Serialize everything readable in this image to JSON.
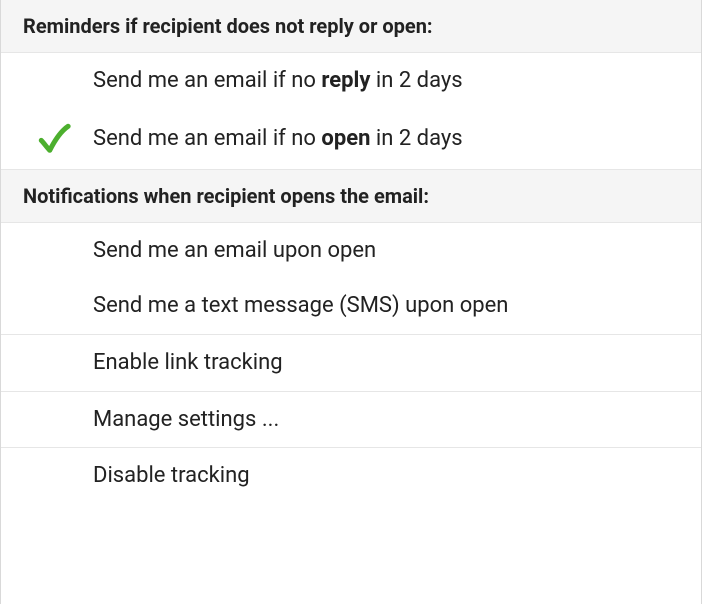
{
  "sections": {
    "reminders": {
      "header": "Reminders if recipient does not reply or open:",
      "items": {
        "no_reply": {
          "prefix": "Send me an email if no ",
          "bold": "reply",
          "suffix": " in 2 days",
          "checked": false
        },
        "no_open": {
          "prefix": "Send me an email if no ",
          "bold": "open",
          "suffix": " in 2 days",
          "checked": true
        }
      }
    },
    "notifications": {
      "header": "Notifications when recipient opens the email:",
      "items": {
        "email_on_open": {
          "label": "Send me an email upon open",
          "checked": false
        },
        "sms_on_open": {
          "label": "Send me a text message (SMS) upon open",
          "checked": false
        }
      }
    },
    "actions": {
      "enable_link_tracking": {
        "label": "Enable link tracking"
      },
      "manage_settings": {
        "label": "Manage settings ..."
      },
      "disable_tracking": {
        "label": "Disable tracking"
      }
    }
  },
  "colors": {
    "check_green": "#4caf2e"
  }
}
